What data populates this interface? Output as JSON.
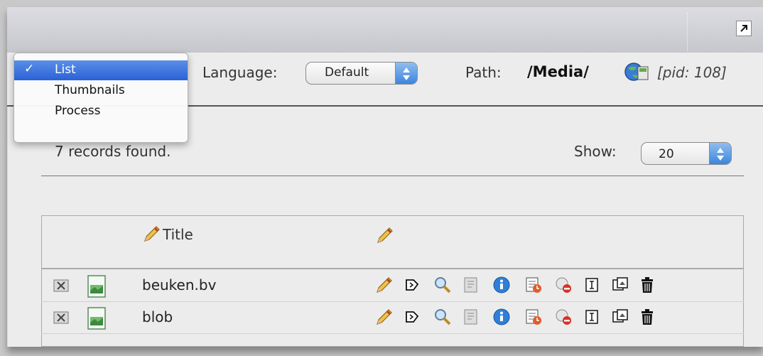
{
  "toolbar": {
    "view_menu": {
      "options": [
        "List",
        "Thumbnails",
        "Process"
      ],
      "selected": "List",
      "check": "✓"
    },
    "language_label": "Language:",
    "language_value": "Default",
    "path_label": "Path:",
    "path_value": "/Media/",
    "pid_text": "[pid: 108]"
  },
  "listing": {
    "records_text": "7 records found.",
    "show_label": "Show:",
    "show_value": "20"
  },
  "table": {
    "columns": [
      "Title"
    ],
    "rows": [
      {
        "name": "beuken.bv"
      },
      {
        "name": "blob"
      }
    ],
    "row_actions": [
      "edit-icon",
      "move-icon",
      "view-icon",
      "localize-icon",
      "info-icon",
      "schedule-icon",
      "hide-icon",
      "rename-icon",
      "copy-icon",
      "delete-icon"
    ]
  },
  "colors": {
    "accent": "#2a61d8",
    "panel": "#ececec",
    "header": "#c6c7cc"
  }
}
